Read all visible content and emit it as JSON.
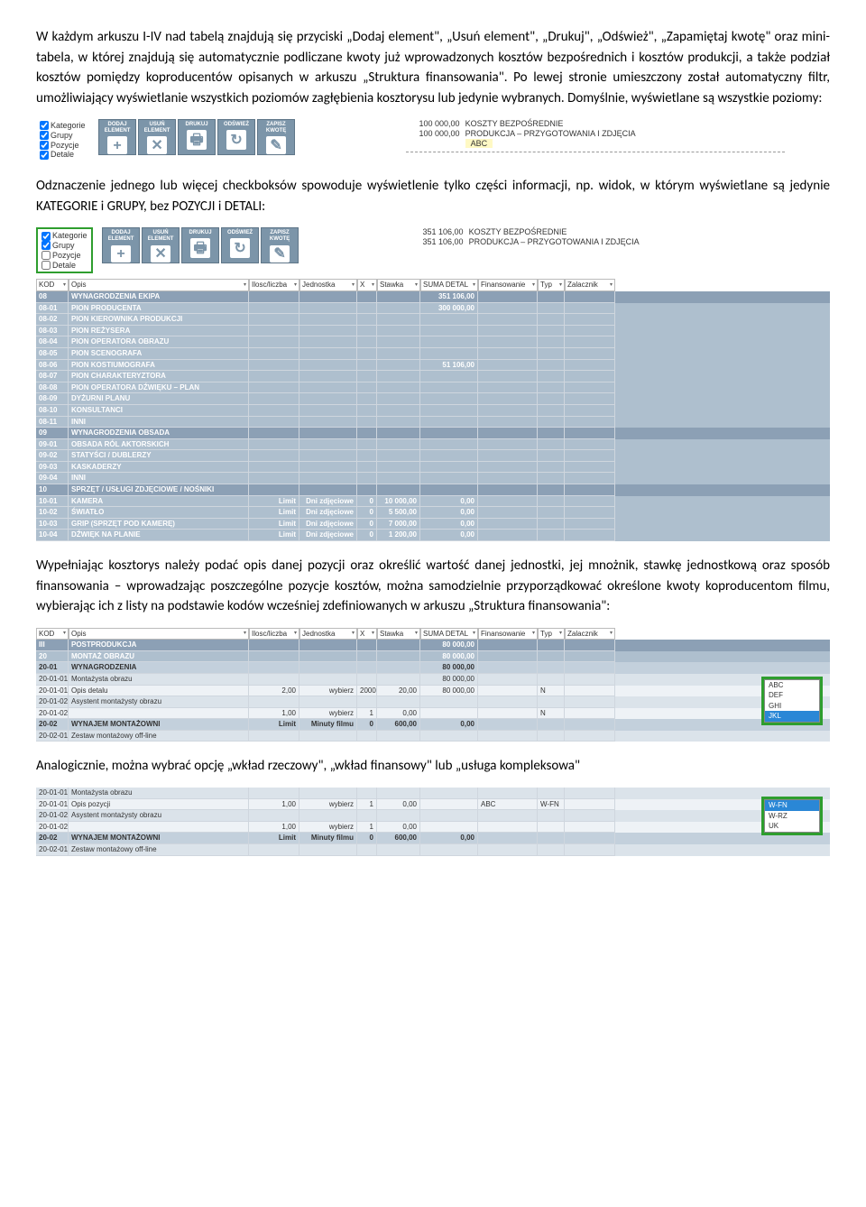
{
  "p1": "W każdym arkuszu I-IV nad tabelą znajdują się przyciski „Dodaj element\", „Usuń element\", „Drukuj\", „Odśwież\", „Zapamiętaj kwotę\" oraz mini-tabela, w której znajdują się automatycznie podliczane kwoty już wprowadzonych kosztów bezpośrednich i kosztów produkcji, a także podział kosztów pomiędzy koproducentów opisanych w arkuszu „Struktura finansowania\". Po lewej stronie umieszczony został automatyczny filtr, umożliwiający wyświetlanie wszystkich poziomów zagłębienia kosztorysu lub jedynie wybranych. Domyślnie, wyświetlane są wszystkie poziomy:",
  "p2": "Odznaczenie jednego lub więcej checkboksów spowoduje wyświetlenie tylko części informacji, np. widok, w którym wyświetlane są jedynie KATEGORIE i GRUPY, bez POZYCJI i DETALI:",
  "p3": "Wypełniając kosztorys należy podać opis danej pozycji oraz określić wartość danej jednostki, jej mnożnik, stawkę jednostkową oraz sposób finansowania – wprowadzając poszczególne pozycje kosztów, można samodzielnie przyporządkować określone kwoty koproducentom filmu, wybierając ich z listy na podstawie kodów wcześniej zdefiniowanych w arkuszu „Struktura finansowania\":",
  "p4": "Analogicznie, można wybrać opcję „wkład rzeczowy\", „wkład finansowy\" lub „usługa kompleksowa\"",
  "filters": {
    "kategorie": "Kategorie",
    "grupy": "Grupy",
    "pozycje": "Pozycje",
    "detale": "Detale"
  },
  "toolbar": {
    "dodaj": "DODAJ ELEMENT",
    "dodaj_g": "+",
    "usun": "USUŃ ELEMENT",
    "usun_g": "✕",
    "drukuj": "DRUKUJ",
    "drukuj_g": "🖶",
    "odswiez": "ODŚWIEŻ",
    "odswiez_g": "↻",
    "zapisz": "ZAPISZ KWOTĘ",
    "zapisz_g": "✎"
  },
  "mini1": {
    "r1a": "100 000,00",
    "r1b": "KOSZTY BEZPOŚREDNIE",
    "r2a": "100 000,00",
    "r2b": "PRODUKCJA – PRZYGOTOWANIA I ZDJĘCIA",
    "abc": "ABC"
  },
  "mini2": {
    "r1a": "351 106,00",
    "r1b": "KOSZTY BEZPOŚREDNIE",
    "r2a": "351 106,00",
    "r2b": "PRODUKCJA – PRZYGOTOWANIA I ZDJĘCIA"
  },
  "cols": {
    "kod": "KOD",
    "opis": "Opis",
    "ilosc": "Ilosc/liczba",
    "jedn": "Jednostka",
    "x": "X",
    "stawka": "Stawka",
    "suma": "SUMA DETAL",
    "fin": "Finansowanie",
    "typ": "Typ",
    "zal": "Zalacznik"
  },
  "rows2": [
    {
      "c": "lvl1",
      "k": "08",
      "o": "WYNAGRODZENIA EKIPA",
      "s": "351 106,00"
    },
    {
      "c": "lvl2",
      "k": "08-01",
      "o": "PION PRODUCENTA",
      "s": "300 000,00"
    },
    {
      "c": "lvl2",
      "k": "08-02",
      "o": "PION KIEROWNIKA PRODUKCJI"
    },
    {
      "c": "lvl2",
      "k": "08-03",
      "o": "PION REŻYSERA"
    },
    {
      "c": "lvl2",
      "k": "08-04",
      "o": "PION OPERATORA OBRAZU"
    },
    {
      "c": "lvl2",
      "k": "08-05",
      "o": "PION SCENOGRAFA"
    },
    {
      "c": "lvl2",
      "k": "08-06",
      "o": "PION KOSTIUMOGRAFA",
      "s": "51 106,00"
    },
    {
      "c": "lvl2",
      "k": "08-07",
      "o": "PION CHARAKTERYZTORA"
    },
    {
      "c": "lvl2",
      "k": "08-08",
      "o": "PION OPERATORA DŹWIĘKU – PLAN"
    },
    {
      "c": "lvl2",
      "k": "08-09",
      "o": "DYŻURNI PLANU"
    },
    {
      "c": "lvl2",
      "k": "08-10",
      "o": "KONSULTANCI"
    },
    {
      "c": "lvl2",
      "k": "08-11",
      "o": "INNI"
    },
    {
      "c": "lvl1",
      "k": "09",
      "o": "WYNAGRODZENIA OBSADA"
    },
    {
      "c": "lvl2",
      "k": "09-01",
      "o": "OBSADA RÓL AKTORSKICH"
    },
    {
      "c": "lvl2",
      "k": "09-02",
      "o": "STATYŚCI / DUBLERZY"
    },
    {
      "c": "lvl2",
      "k": "09-03",
      "o": "KASKADERZY"
    },
    {
      "c": "lvl2",
      "k": "09-04",
      "o": "INNI"
    },
    {
      "c": "lvl1",
      "k": "10",
      "o": "SPRZĘT / USŁUGI ZDJĘCIOWE / NOŚNIKI"
    },
    {
      "c": "lvl2",
      "k": "10-01",
      "o": "KAMERA",
      "il": "Limit",
      "j": "Dni zdjęciowe",
      "x": "0",
      "st": "10 000,00",
      "s": "0,00"
    },
    {
      "c": "lvl2",
      "k": "10-02",
      "o": "ŚWIATŁO",
      "il": "Limit",
      "j": "Dni zdjęciowe",
      "x": "0",
      "st": "5 500,00",
      "s": "0,00"
    },
    {
      "c": "lvl2",
      "k": "10-03",
      "o": "GRIP (SPRZĘT POD KAMERĘ)",
      "il": "Limit",
      "j": "Dni zdjęciowe",
      "x": "0",
      "st": "7 000,00",
      "s": "0,00"
    },
    {
      "c": "lvl2",
      "k": "10-04",
      "o": "DŹWIĘK NA PLANIE",
      "il": "Limit",
      "j": "Dni zdjęciowe",
      "x": "0",
      "st": "1 200,00",
      "s": "0,00"
    }
  ],
  "rows3": [
    {
      "c": "lvl1",
      "k": "III",
      "o": "POSTPRODUKCJA",
      "s": "80 000,00"
    },
    {
      "c": "lvl2",
      "k": "20",
      "o": "MONTAŻ OBRAZU",
      "s": "80 000,00"
    },
    {
      "c": "lvl3",
      "k": "20-01",
      "o": "WYNAGRODZENIA",
      "s": "80 000,00"
    },
    {
      "c": "lvl4",
      "k": "20-01-01",
      "o": "Montażysta obrazu",
      "s": "80 000,00"
    },
    {
      "c": "lvl5",
      "k": "20-01-01-01",
      "o": "Opis detalu",
      "il": "2,00",
      "j": "wybierz",
      "x": "2000",
      "st": "20,00",
      "s": "80 000,00",
      "f": "",
      "t": "N"
    },
    {
      "c": "lvl4",
      "k": "20-01-02",
      "o": "Asystent montażysty obrazu"
    },
    {
      "c": "lvl5",
      "k": "20-01-02-01",
      "o": "",
      "il": "1,00",
      "j": "wybierz",
      "x": "1",
      "st": "0,00",
      "s": "",
      "f": "",
      "t": "N"
    },
    {
      "c": "lvl3",
      "k": "20-02",
      "o": "WYNAJEM MONTAŻOWNI",
      "il": "Limit",
      "j": "Minuty filmu",
      "x": "0",
      "st": "600,00",
      "s": "0,00"
    },
    {
      "c": "lvl4",
      "k": "20-02-01",
      "o": "Zestaw montażowy off-line"
    }
  ],
  "dd1": {
    "items": [
      "ABC",
      "DEF",
      "GHI",
      "JKL"
    ],
    "sel": "JKL"
  },
  "rows4": [
    {
      "c": "lvl4",
      "k": "20-01-01",
      "o": "Montażysta obrazu"
    },
    {
      "c": "lvl5",
      "k": "20-01-01-01",
      "o": "Opis pozycji",
      "il": "1,00",
      "j": "wybierz",
      "x": "1",
      "st": "0,00",
      "s": "",
      "f": "ABC",
      "t": "W-FN"
    },
    {
      "c": "lvl4",
      "k": "20-01-02",
      "o": "Asystent montażysty obrazu"
    },
    {
      "c": "lvl5",
      "k": "20-01-02-01",
      "o": "",
      "il": "1,00",
      "j": "wybierz",
      "x": "1",
      "st": "0,00",
      "s": "",
      "f": "",
      "t": ""
    },
    {
      "c": "lvl3",
      "k": "20-02",
      "o": "WYNAJEM MONTAŻOWNI",
      "il": "Limit",
      "j": "Minuty filmu",
      "x": "0",
      "st": "600,00",
      "s": "0,00"
    },
    {
      "c": "lvl4",
      "k": "20-02-01",
      "o": "Zestaw montażowy off-line"
    }
  ],
  "dd2": {
    "items": [
      "W-FN",
      "W-RZ",
      "UK"
    ],
    "sel": "W-FN"
  }
}
